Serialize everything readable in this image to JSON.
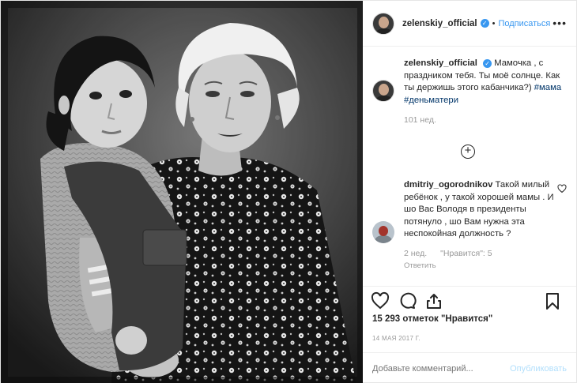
{
  "post": {
    "username": "zelenskiy_official",
    "verified_icon": "verified-badge-icon",
    "dot": "•",
    "follow_label": "Подписаться",
    "more_label": "•••"
  },
  "caption": {
    "username": "zelenskiy_official",
    "text": "Мамочка , с праздником тебя. Ты моё солнце. Как ты держишь этого кабанчика?)",
    "tags": "#мама #деньматери",
    "age": "101 нед."
  },
  "load_more": {
    "icon": "plus-circle-icon",
    "label": "+"
  },
  "comment": {
    "username": "dmitriy_ogorodnikov",
    "text": "Такой милый ребёнок , у такой хорошей мамы . И шо Вас Володя в президенты потянуло , шо Вам нужна эта неспокойная должность ?",
    "age": "2 нед.",
    "likes": "\"Нравится\": 5",
    "reply_label": "Ответить"
  },
  "actions": {
    "like_icon": "heart-icon",
    "comment_icon": "comment-icon",
    "share_icon": "share-icon",
    "save_icon": "bookmark-icon"
  },
  "likes_text": "15 293 отметок \"Нравится\"",
  "date": "14 МАЯ 2017 Г.",
  "add_comment": {
    "placeholder": "Добавьте комментарий...",
    "publish_label": "Опубликовать"
  },
  "colors": {
    "accent": "#3897f0",
    "publish_disabled": "#b2dffc",
    "hashtag": "#003569",
    "muted": "#999999"
  }
}
